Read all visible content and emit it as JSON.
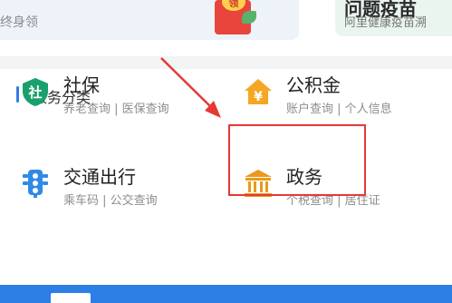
{
  "banner": {
    "left": {
      "title_dark": "",
      "title_blue": "",
      "subtitle": "终身领"
    },
    "envelope_label": "领",
    "right": {
      "title": "问题疫苗",
      "subtitle": "阿里健康疫苗溯"
    }
  },
  "section": {
    "title": "服务分类"
  },
  "services": [
    {
      "name": "社保",
      "sub": "养老查询 | 医保查询",
      "icon": "shield-she-icon",
      "icon_char": "社"
    },
    {
      "name": "公积金",
      "sub": "账户查询 | 个人信息",
      "icon": "house-yuan-icon",
      "icon_char": "¥"
    },
    {
      "name": "交通出行",
      "sub": "乘车码 | 公交查询",
      "icon": "traffic-light-icon"
    },
    {
      "name": "政务",
      "sub": "个税查询 | 居住证",
      "icon": "government-building-icon"
    }
  ],
  "colors": {
    "accent": "#2f7de1",
    "shebao_green": "#1aa06d",
    "gjj_orange": "#f5a623",
    "traffic_blue": "#2f8ae6",
    "gov_orange": "#e99a1c",
    "annotation_red": "#e53935"
  }
}
